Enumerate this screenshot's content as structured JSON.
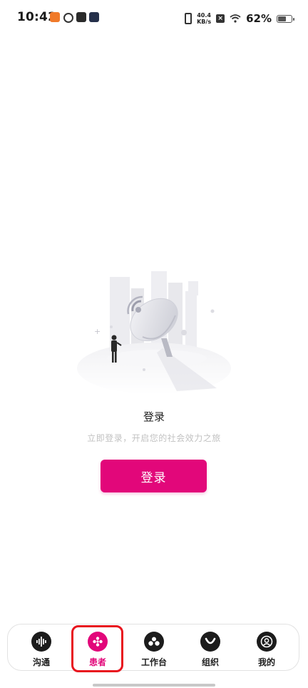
{
  "status_bar": {
    "time": "10:42",
    "net_speed_value": "40.4",
    "net_speed_unit": "KB/s",
    "battery_percent": "62%",
    "battery_level": 0.62
  },
  "main": {
    "login_title": "登录",
    "login_subtitle": "立即登录，开启您的社会效力之旅",
    "login_button": "登录"
  },
  "bottom_nav": {
    "items": [
      {
        "label": "沟通",
        "icon": "waveform-icon"
      },
      {
        "label": "患者",
        "icon": "flower-icon"
      },
      {
        "label": "工作台",
        "icon": "people-icon"
      },
      {
        "label": "组织",
        "icon": "smile-icon"
      },
      {
        "label": "我的",
        "icon": "user-profile-icon"
      }
    ],
    "active_index": 1
  },
  "colors": {
    "brand": "#e2077a",
    "highlight_frame": "#e8141e",
    "icon_dark": "#1c1c1c"
  }
}
